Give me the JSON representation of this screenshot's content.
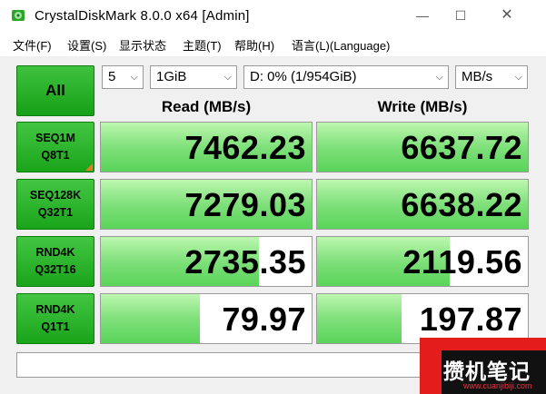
{
  "window": {
    "title": "CrystalDiskMark 8.0.0 x64 [Admin]",
    "controls": {
      "minimize": "—",
      "maximize": "☐",
      "close": "✕"
    }
  },
  "menu": [
    "文件(F)",
    "设置(S)",
    "显示状态",
    "主题(T)",
    "帮助(H)",
    "语言(L)(Language)"
  ],
  "toolbar": {
    "all_label": "All",
    "count": "5",
    "size": "1GiB",
    "drive": "D: 0% (1/954GiB)",
    "unit": "MB/s"
  },
  "headers": {
    "read": "Read (MB/s)",
    "write": "Write (MB/s)"
  },
  "tests": [
    {
      "line1": "SEQ1M",
      "line2": "Q8T1",
      "read": "7462.23",
      "write": "6637.72",
      "read_fill": 1.0,
      "write_fill": 1.0
    },
    {
      "line1": "SEQ128K",
      "line2": "Q32T1",
      "read": "7279.03",
      "write": "6638.22",
      "read_fill": 1.0,
      "write_fill": 1.0
    },
    {
      "line1": "RND4K",
      "line2": "Q32T16",
      "read": "2735.35",
      "write": "2119.56",
      "read_fill": 0.75,
      "write_fill": 0.63
    },
    {
      "line1": "RND4K",
      "line2": "Q1T1",
      "read": "79.97",
      "write": "197.87",
      "read_fill": 0.47,
      "write_fill": 0.4
    }
  ],
  "watermark": {
    "text": "攒机笔记",
    "url": "www.cuanjibiji.com"
  },
  "colors": {
    "button_green": "#1aa41a",
    "bar_green": "#7fe07a",
    "watermark_red": "#e51c1c"
  }
}
